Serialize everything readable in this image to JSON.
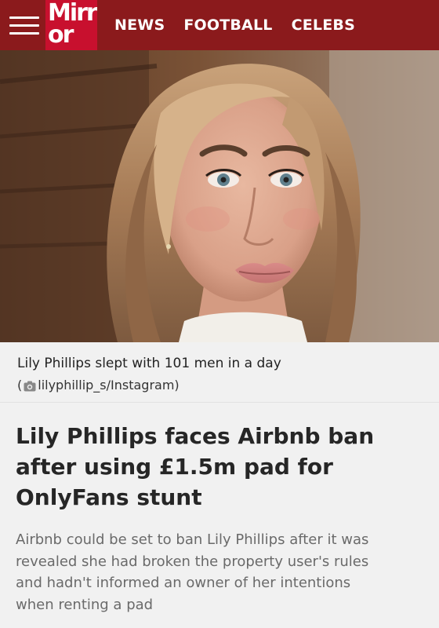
{
  "header": {
    "logo_top": "Mirr",
    "logo_bottom": "or",
    "nav": [
      "NEWS",
      "FOOTBALL",
      "CELEBS"
    ],
    "colors": {
      "header_bg": "#8b1a1c",
      "logo_bg": "#c8102e"
    }
  },
  "hero": {
    "alt": "Lily Phillips"
  },
  "caption": {
    "title": "Lily Phillips slept with 101 men in a day",
    "credit_open": "(",
    "credit_icon": "camera-icon",
    "credit_text": "lilyphillip_s/Instagram)"
  },
  "article": {
    "headline_lines": [
      "Lily Phillips faces Airbnb ban",
      "after using £1.5m pad for",
      "OnlyFans stunt"
    ],
    "standfirst_lines": [
      "Airbnb could be set to ban Lily Phillips after it was",
      "revealed she had broken the property user's rules",
      "and hadn't informed an owner of her intentions",
      "when renting a pad"
    ]
  }
}
